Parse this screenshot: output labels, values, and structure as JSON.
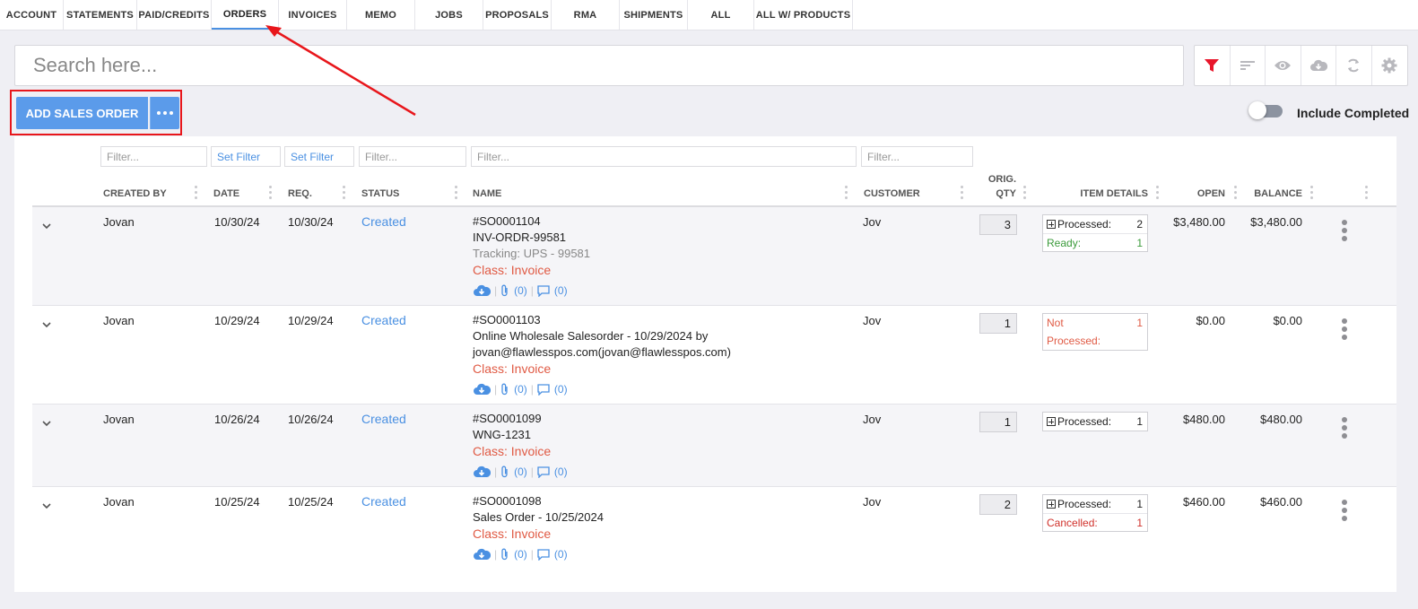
{
  "tabs": [
    {
      "label": "ACCOUNT",
      "active": false
    },
    {
      "label": "STATEMENTS",
      "active": false
    },
    {
      "label": "PAID/CREDITS",
      "active": false
    },
    {
      "label": "ORDERS",
      "active": true
    },
    {
      "label": "INVOICES",
      "active": false
    },
    {
      "label": "MEMO",
      "active": false
    },
    {
      "label": "JOBS",
      "active": false
    },
    {
      "label": "PROPOSALS",
      "active": false
    },
    {
      "label": "RMA",
      "active": false
    },
    {
      "label": "SHIPMENTS",
      "active": false
    },
    {
      "label": "ALL",
      "active": false
    },
    {
      "label": "ALL W/ PRODUCTS",
      "active": false
    }
  ],
  "search": {
    "placeholder": "Search here..."
  },
  "toolbar": {
    "icons": [
      "filter-icon",
      "sort-icon",
      "eye-icon",
      "cloud-download-icon",
      "refresh-icon",
      "gear-icon"
    ]
  },
  "actions": {
    "add_label": "ADD SALES ORDER"
  },
  "toggle": {
    "label": "Include Completed",
    "on": false
  },
  "filters": {
    "created_by": "Filter...",
    "date": "Set Filter",
    "req": "Set Filter",
    "status": "Filter...",
    "name": "Filter...",
    "customer": "Filter..."
  },
  "columns": {
    "created_by": "CREATED BY",
    "date": "DATE",
    "req": "REQ.",
    "status": "STATUS",
    "name": "NAME",
    "customer": "CUSTOMER",
    "orig_qty_1": "ORIG.",
    "orig_qty_2": "QTY",
    "item_details": "ITEM DETAILS",
    "open": "OPEN",
    "balance": "BALANCE"
  },
  "rows": [
    {
      "created_by": "Jovan",
      "date": "10/30/24",
      "req": "10/30/24",
      "status": "Created",
      "so": "#SO0001104",
      "name1": "INV-ORDR-99581",
      "tracking": "Tracking: UPS - 99581",
      "cls": "Class: Invoice",
      "attach_count": "(0)",
      "comment_count": "(0)",
      "customer": "Jov",
      "qty": "3",
      "d1_label": "Processed:",
      "d1_val": "2",
      "d2_label": "Ready:",
      "d2_val": "1",
      "open": "$3,480.00",
      "balance": "$3,480.00"
    },
    {
      "created_by": "Jovan",
      "date": "10/29/24",
      "req": "10/29/24",
      "status": "Created",
      "so": "#SO0001103",
      "name1": "Online Wholesale Salesorder - 10/29/2024 by",
      "name2": "jovan@flawlesspos.com(jovan@flawlesspos.com)",
      "cls": "Class: Invoice",
      "attach_count": "(0)",
      "comment_count": "(0)",
      "customer": "Jov",
      "qty": "1",
      "d1_label": "Not",
      "d1_val": "1",
      "d2_label": "Processed:",
      "open": "$0.00",
      "balance": "$0.00"
    },
    {
      "created_by": "Jovan",
      "date": "10/26/24",
      "req": "10/26/24",
      "status": "Created",
      "so": "#SO0001099",
      "name1": "WNG-1231",
      "cls": "Class: Invoice",
      "attach_count": "(0)",
      "comment_count": "(0)",
      "customer": "Jov",
      "qty": "1",
      "d1_label": "Processed:",
      "d1_val": "1",
      "open": "$480.00",
      "balance": "$480.00"
    },
    {
      "created_by": "Jovan",
      "date": "10/25/24",
      "req": "10/25/24",
      "status": "Created",
      "so": "#SO0001098",
      "name1": "Sales Order - 10/25/2024",
      "cls": "Class: Invoice",
      "attach_count": "(0)",
      "comment_count": "(0)",
      "customer": "Jov",
      "qty": "2",
      "d1_label": "Processed:",
      "d1_val": "1",
      "d2_label": "Cancelled:",
      "d2_val": "1",
      "open": "$460.00",
      "balance": "$460.00"
    }
  ],
  "colors": {
    "accent": "#4a90e2",
    "button": "#5b9bea",
    "highlight": "#e8161b",
    "class": "#e05a44",
    "ready": "#3a9a3a",
    "not_processed": "#e05a44",
    "cancelled": "#d0302a"
  }
}
